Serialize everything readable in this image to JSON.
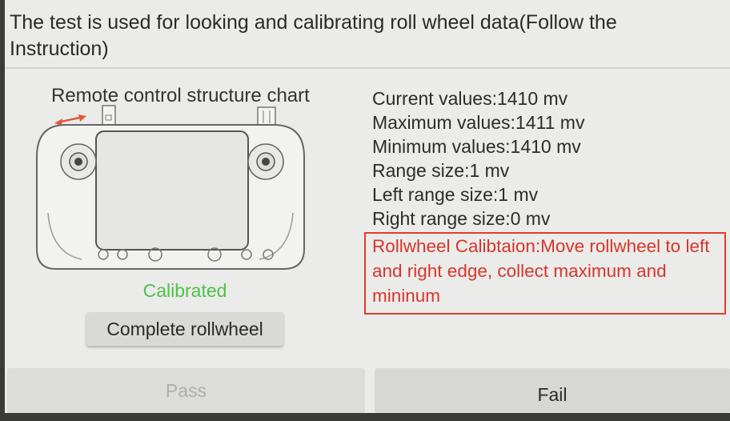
{
  "header": {
    "instruction_title": "The test is used for looking and calibrating roll wheel data(Follow the Instruction)"
  },
  "left_panel": {
    "chart_title": "Remote control structure chart",
    "status_text": "Calibrated",
    "status_color": "#4cc24a",
    "complete_button_label": "Complete rollwheel"
  },
  "readings": {
    "current": "Current values:1410 mv",
    "maximum": "Maximum values:1411 mv",
    "minimum": "Minimum values:1410 mv",
    "range": "Range size:1 mv",
    "left_range": "Left range size:1 mv",
    "right_range": "Right range size:0 mv"
  },
  "calibration_note": {
    "text": "Rollwheel Calibtaion:Move rollwheel to left and right edge, collect maximum and mininum",
    "color": "#d8352a"
  },
  "footer": {
    "pass_label": "Pass",
    "fail_label": "Fail"
  }
}
